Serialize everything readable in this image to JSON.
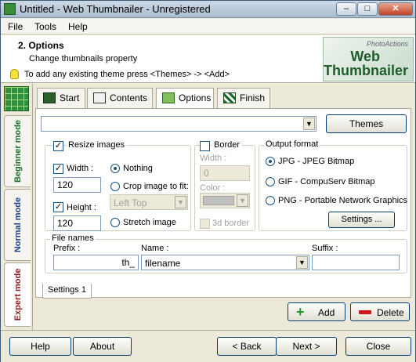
{
  "window": {
    "title": "Untitled - Web Thumbnailer - Unregistered"
  },
  "menu": [
    "File",
    "Tools",
    "Help"
  ],
  "header": {
    "title": "2. Options",
    "subtitle": "Change thumbnails property",
    "tip": "To add any existing theme press <Themes> -> <Add>",
    "logo_line1": "PhotoActions",
    "logo_line2": "Web",
    "logo_line3": "Thumbnailer"
  },
  "modes": [
    "Beginner mode",
    "Normal mode",
    "Expert mode"
  ],
  "tabs": [
    "Start",
    "Contents",
    "Options",
    "Finish"
  ],
  "themes_button": "Themes",
  "resize": {
    "label": "Resize images",
    "width_label": "Width :",
    "width_value": "120",
    "height_label": "Height :",
    "height_value": "120",
    "opt_nothing": "Nothing",
    "opt_crop": "Crop image to fit:",
    "crop_value": "Left Top",
    "opt_stretch": "Stretch image"
  },
  "border": {
    "label": "Border",
    "width_label": "Width :",
    "width_value": "0",
    "color_label": "Color :",
    "border3d": "3d border"
  },
  "output": {
    "label": "Output format",
    "jpg": "JPG - JPEG Bitmap",
    "gif": "GIF - CompuServ Bitmap",
    "png": "PNG - Portable Network Graphics",
    "settings": "Settings ..."
  },
  "filenames": {
    "label": "File names",
    "prefix_label": "Prefix :",
    "prefix_value": "th_",
    "name_label": "Name :",
    "name_value": "filename",
    "suffix_label": "Suffix :",
    "suffix_value": ""
  },
  "settings_tab": "Settings 1",
  "add_button": "Add",
  "delete_button": "Delete",
  "bottom": {
    "help": "Help",
    "about": "About",
    "back": "< Back",
    "next": "Next >",
    "close": "Close"
  },
  "colors": {
    "accent_green": "#1d5e2c",
    "mode_beginner": "#1d6e2f",
    "mode_normal": "#1d3f8a",
    "mode_expert": "#8a1d1d"
  }
}
